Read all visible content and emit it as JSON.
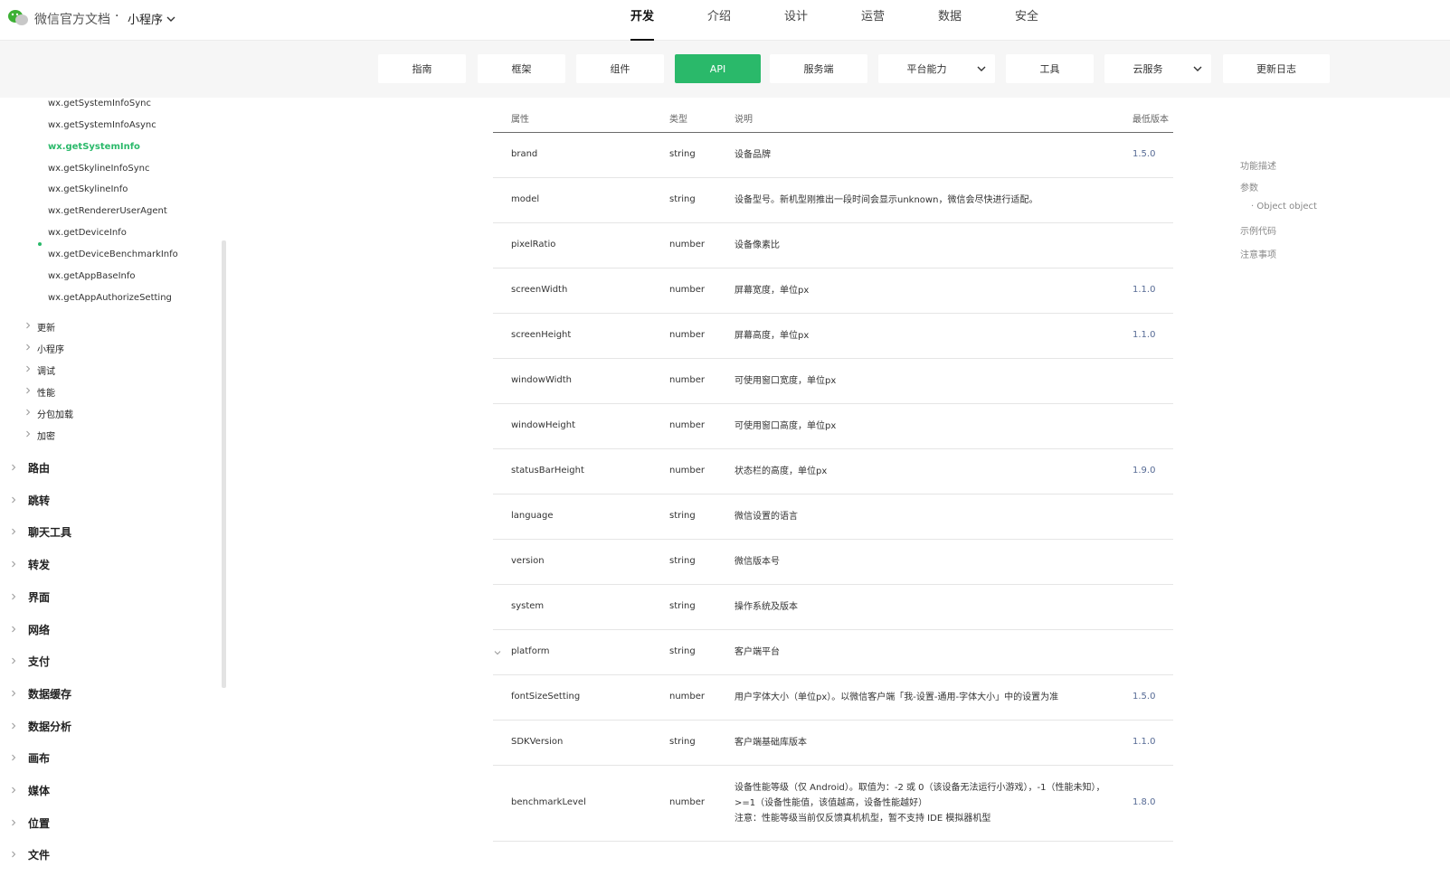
{
  "header": {
    "brand": "微信官方文档",
    "separator": "·",
    "product": "小程序",
    "nav": [
      "开发",
      "介绍",
      "设计",
      "运营",
      "数据",
      "安全"
    ],
    "active_nav": "开发"
  },
  "subnav": {
    "items": [
      {
        "label": "指南"
      },
      {
        "label": "框架"
      },
      {
        "label": "组件"
      },
      {
        "label": "API",
        "active": true
      },
      {
        "label": "服务端"
      },
      {
        "label": "平台能力",
        "dropdown": true
      },
      {
        "label": "工具"
      },
      {
        "label": "云服务",
        "dropdown": true
      },
      {
        "label": "更新日志"
      }
    ]
  },
  "sidebar": {
    "leaves": [
      "wx.getSystemInfoSync",
      "wx.getSystemInfoAsync",
      "wx.getSystemInfo",
      "wx.getSkylineInfoSync",
      "wx.getSkylineInfo",
      "wx.getRendererUserAgent",
      "wx.getDeviceInfo",
      "wx.getDeviceBenchmarkInfo",
      "wx.getAppBaseInfo",
      "wx.getAppAuthorizeSetting"
    ],
    "active_leaf": "wx.getSystemInfo",
    "groups": [
      "更新",
      "小程序",
      "调试",
      "性能",
      "分包加载",
      "加密"
    ],
    "categories": [
      "路由",
      "跳转",
      "聊天工具",
      "转发",
      "界面",
      "网络",
      "支付",
      "数据缓存",
      "数据分析",
      "画布",
      "媒体",
      "位置",
      "文件"
    ]
  },
  "table": {
    "headers": {
      "name": "属性",
      "type": "类型",
      "desc": "说明",
      "version": "最低版本"
    },
    "rows": [
      {
        "name": "brand",
        "type": "string",
        "desc": "设备品牌",
        "version": "1.5.0"
      },
      {
        "name": "model",
        "type": "string",
        "desc": "设备型号。新机型刚推出一段时间会显示unknown，微信会尽快进行适配。",
        "version": ""
      },
      {
        "name": "pixelRatio",
        "type": "number",
        "desc": "设备像素比",
        "version": ""
      },
      {
        "name": "screenWidth",
        "type": "number",
        "desc": "屏幕宽度，单位px",
        "version": "1.1.0"
      },
      {
        "name": "screenHeight",
        "type": "number",
        "desc": "屏幕高度，单位px",
        "version": "1.1.0"
      },
      {
        "name": "windowWidth",
        "type": "number",
        "desc": "可使用窗口宽度，单位px",
        "version": ""
      },
      {
        "name": "windowHeight",
        "type": "number",
        "desc": "可使用窗口高度，单位px",
        "version": ""
      },
      {
        "name": "statusBarHeight",
        "type": "number",
        "desc": "状态栏的高度，单位px",
        "version": "1.9.0"
      },
      {
        "name": "language",
        "type": "string",
        "desc": "微信设置的语言",
        "version": ""
      },
      {
        "name": "version",
        "type": "string",
        "desc": "微信版本号",
        "version": ""
      },
      {
        "name": "system",
        "type": "string",
        "desc": "操作系统及版本",
        "version": ""
      },
      {
        "name": "platform",
        "type": "string",
        "desc": "客户端平台",
        "version": "",
        "expandable": true
      },
      {
        "name": "fontSizeSetting",
        "type": "number",
        "desc": "用户字体大小（单位px）。以微信客户端「我-设置-通用-字体大小」中的设置为准",
        "version": "1.5.0"
      },
      {
        "name": "SDKVersion",
        "type": "string",
        "desc": "客户端基础库版本",
        "version": "1.1.0"
      },
      {
        "name": "benchmarkLevel",
        "type": "number",
        "desc": "设备性能等级（仅 Android）。取值为：-2 或 0（该设备无法运行小游戏），-1（性能未知），>=1（设备性能值，该值越高，设备性能越好）\n注意：性能等级当前仅反馈真机机型，暂不支持 IDE 模拟器机型",
        "version": "1.8.0"
      }
    ]
  },
  "toc": {
    "items": [
      {
        "label": "功能描述",
        "sub": false
      },
      {
        "label": "参数",
        "sub": false
      },
      {
        "label": "· Object object",
        "sub": true
      },
      {
        "label": "示例代码",
        "sub": false
      },
      {
        "label": "注意事项",
        "sub": false
      }
    ]
  },
  "colors": {
    "accent": "#2ab96a",
    "link": "#576b95",
    "subnav_bg": "#f6f6f6"
  }
}
